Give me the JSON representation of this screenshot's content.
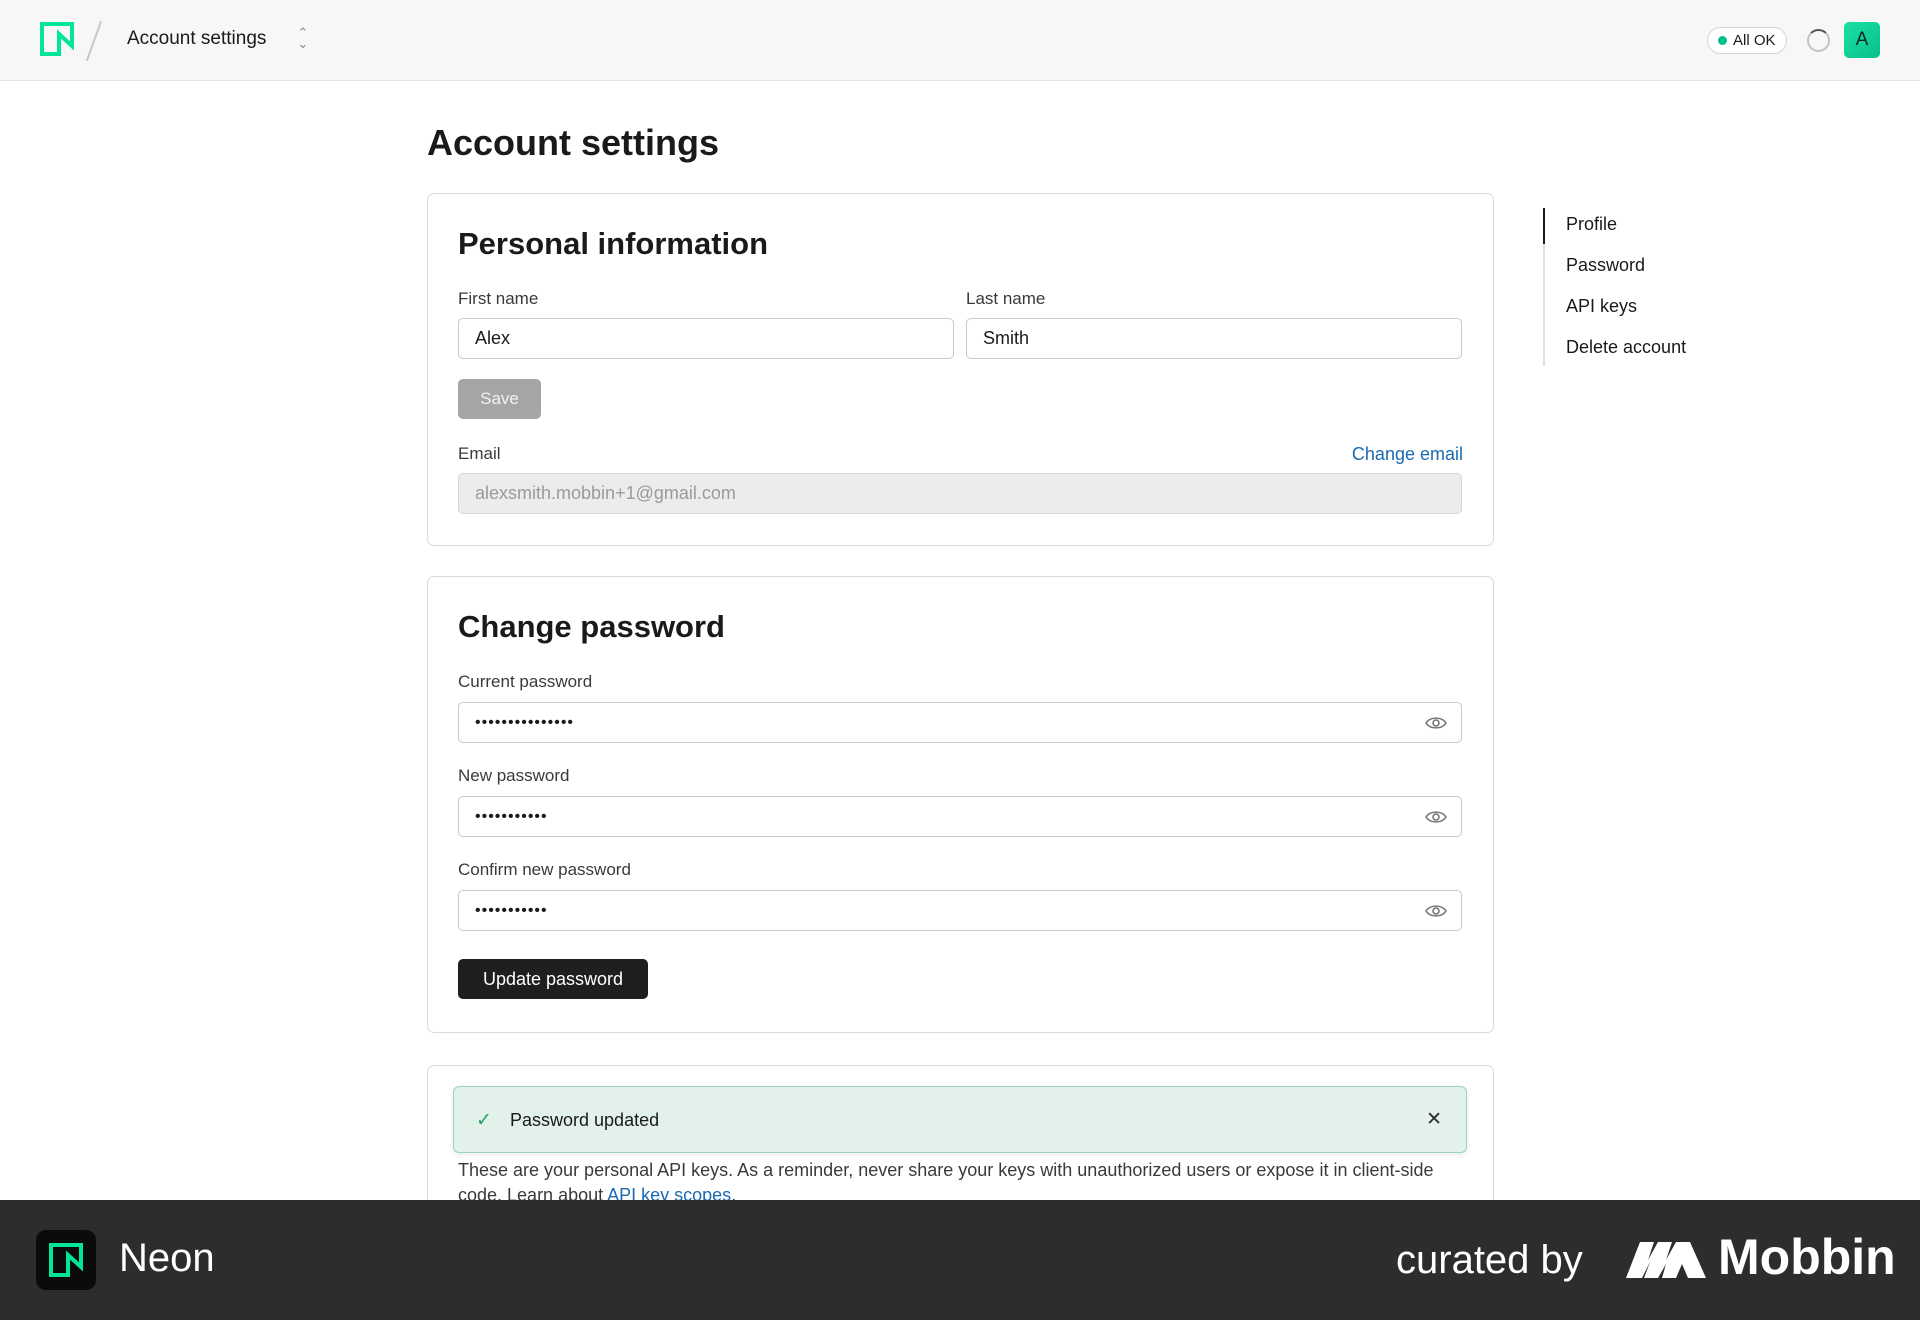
{
  "app": {
    "name": "Neon",
    "breadcrumb": "Account settings",
    "status": "All OK",
    "avatar_initial": "A",
    "brand_color": "#00e599"
  },
  "page": {
    "title": "Account settings"
  },
  "personal": {
    "heading": "Personal information",
    "first_name_label": "First name",
    "first_name_value": "Alex",
    "last_name_label": "Last name",
    "last_name_value": "Smith",
    "save_label": "Save",
    "email_label": "Email",
    "change_email_label": "Change email",
    "email_value": "alexsmith.mobbin+1@gmail.com"
  },
  "password": {
    "heading": "Change password",
    "current_label": "Current password",
    "current_value": "•••••••••••••••",
    "new_label": "New password",
    "new_value": "•••••••••••",
    "confirm_label": "Confirm new password",
    "confirm_value": "•••••••••••",
    "update_label": "Update password"
  },
  "toast": {
    "message": "Password updated"
  },
  "api_keys": {
    "intro": "These are your personal API keys. As a reminder, never share your keys with unauthorized users or expose it in client-side code. Learn about ",
    "link": "API key scopes",
    "after": "."
  },
  "sidenav": {
    "items": [
      {
        "label": "Profile"
      },
      {
        "label": "Password"
      },
      {
        "label": "API keys"
      },
      {
        "label": "Delete account"
      }
    ]
  },
  "footer": {
    "app_name": "Neon",
    "curated_by": "curated by",
    "brand": "Mobbin"
  }
}
